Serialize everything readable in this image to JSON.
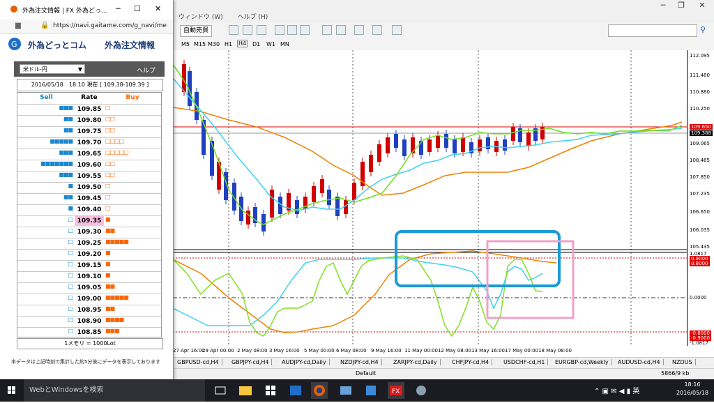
{
  "mt4": {
    "menu": [
      "ウィンドウ (W)",
      "ヘルプ (H)"
    ],
    "autotrade": "自動売買",
    "timeframes": [
      "M5",
      "M15",
      "M30",
      "H1",
      "H4",
      "D1",
      "W1",
      "MN"
    ],
    "price_labels": [
      "112.095",
      "111.480",
      "110.880",
      "110.250",
      "109.650",
      "109.388",
      "109.065",
      "108.465",
      "107.850",
      "107.235",
      "106.650",
      "106.035",
      "105.435"
    ],
    "indicator_labels": [
      "1.0817",
      "0.9000",
      "0.8000",
      "0.0000",
      "-0.8000",
      "-0.9000",
      "-1.0817"
    ],
    "dates": [
      "27 Apr 16:00",
      "29 Apr 00:00",
      "2 May 08:00",
      "3 May 16:00",
      "5 May 00:00",
      "6 May 08:00",
      "9 May 16:00",
      "11 May 00:00",
      "12 May 08:00",
      "13 May 16:00",
      "17 May 00:00",
      "18 May 08:00"
    ],
    "symbol_tabs": [
      "GBPUSD-cd,H4",
      "GBPJPY-cd,H4",
      "AUDJPY-cd,Daily",
      "NZDJPY-cd,H4",
      "ZARJPY-cd,Daily",
      "CHFJPY-cd,H4",
      "USDCHF-cd,H1",
      "EURGBP-cd,Weekly",
      "AUDUSD-cd,H4",
      "NZDUS"
    ],
    "status_profile": "Default",
    "status_traffic": "5866/9 kb"
  },
  "taskbar": {
    "search": "WebとWindowsを検索",
    "time": "18:16",
    "date": "2016/05/18"
  },
  "popup": {
    "title": "外為注文情報 | FX 外為どっ...",
    "url": "https://navi.gaitame.com/g_navi/me",
    "brand": "外為どっとコム",
    "brand_sub": "外為注文情報",
    "pair": "米ドル-円",
    "help": "ヘルプ",
    "info": "2016/05/18　18:10 現在 [ 109.38-109.39 ]",
    "header": {
      "sell": "Sell",
      "rate": "Rate",
      "buy": "Buy"
    },
    "rows": [
      {
        "rate": "109.85",
        "sell": "■■■",
        "buy": "□"
      },
      {
        "rate": "109.80",
        "sell": "■■",
        "buy": "□□"
      },
      {
        "rate": "109.75",
        "sell": "■■",
        "buy": "□□"
      },
      {
        "rate": "109.70",
        "sell": "■■■■■",
        "buy": "□□□□"
      },
      {
        "rate": "109.65",
        "sell": "■■■",
        "buy": "□□□□□"
      },
      {
        "rate": "109.60",
        "sell": "■■■■■■■",
        "buy": "□□"
      },
      {
        "rate": "109.55",
        "sell": "■■■",
        "buy": "□□"
      },
      {
        "rate": "109.50",
        "sell": "■",
        "buy": "□"
      },
      {
        "rate": "109.45",
        "sell": "■■",
        "buy": "□"
      },
      {
        "rate": "109.40",
        "sell": "■",
        "buy": "□"
      },
      {
        "rate": "109.35",
        "sell": "□",
        "buy": "■",
        "mid": true
      },
      {
        "rate": "109.30",
        "sell": "□",
        "buy": "■■"
      },
      {
        "rate": "109.25",
        "sell": "□",
        "buy": "■■■■■"
      },
      {
        "rate": "109.20",
        "sell": "□",
        "buy": "■"
      },
      {
        "rate": "109.15",
        "sell": "□",
        "buy": "■"
      },
      {
        "rate": "109.10",
        "sell": "□",
        "buy": "■"
      },
      {
        "rate": "109.05",
        "sell": "□",
        "buy": "■■"
      },
      {
        "rate": "109.00",
        "sell": "□",
        "buy": "■■■■■"
      },
      {
        "rate": "108.95",
        "sell": "□",
        "buy": "■■"
      },
      {
        "rate": "108.90",
        "sell": "□",
        "buy": "■■■■"
      },
      {
        "rate": "108.85",
        "sell": "□",
        "buy": "■■■"
      }
    ],
    "lot": "1メモリ = 1000Lot",
    "note": "本データは上記時刻で集計した約5分後にデータを表示しております"
  }
}
